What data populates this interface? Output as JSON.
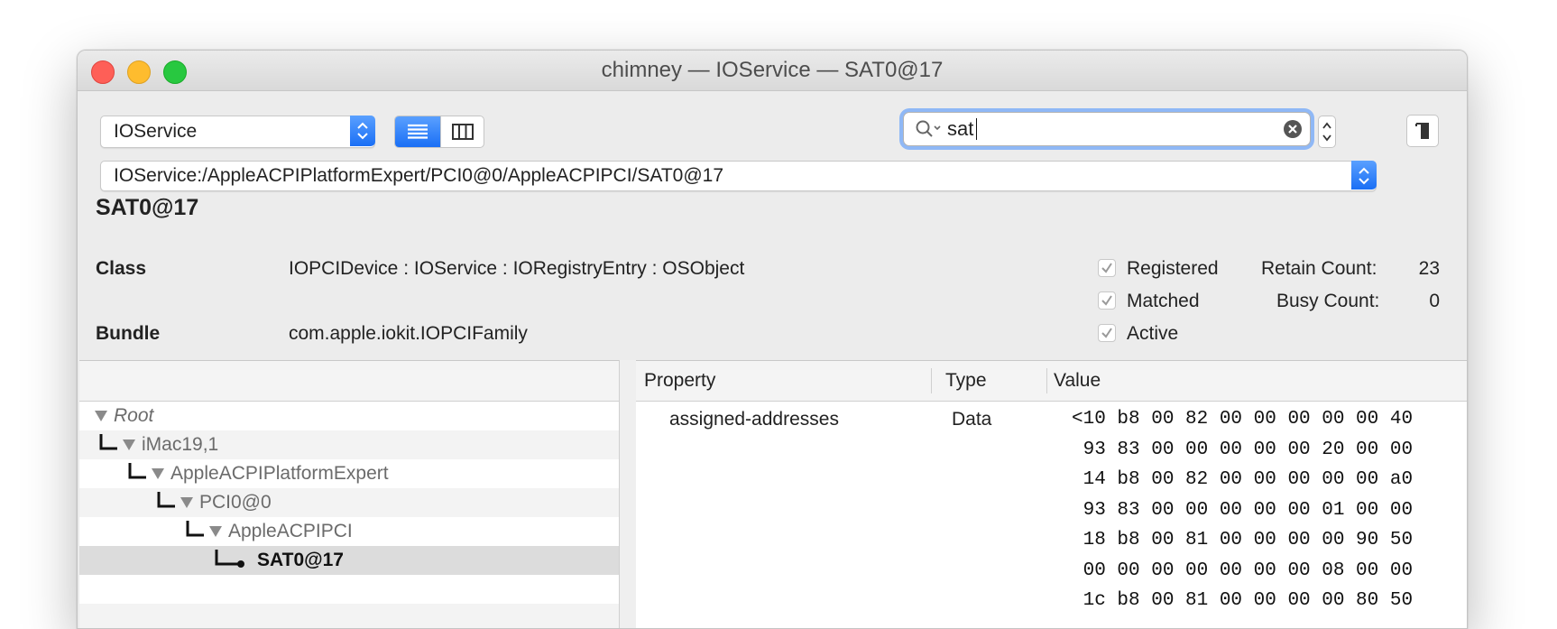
{
  "window": {
    "title": "chimney — IOService — SAT0@17"
  },
  "toolbar": {
    "plane_select": "IOService",
    "search_value": "sat",
    "path": "IOService:/AppleACPIPlatformExpert/PCI0@0/AppleACPIPCI/SAT0@17"
  },
  "details": {
    "name": "SAT0@17",
    "class_label": "Class",
    "class_value": "IOPCIDevice : IOService : IORegistryEntry : OSObject",
    "bundle_label": "Bundle",
    "bundle_value": "com.apple.iokit.IOPCIFamily",
    "checks": [
      "Registered",
      "Matched",
      "Active"
    ],
    "retain_label": "Retain Count:",
    "retain_value": "23",
    "busy_label": "Busy Count:",
    "busy_value": "0"
  },
  "tree": {
    "items": [
      {
        "label": "Root",
        "depth": 0
      },
      {
        "label": "iMac19,1",
        "depth": 1
      },
      {
        "label": "AppleACPIPlatformExpert",
        "depth": 2
      },
      {
        "label": "PCI0@0",
        "depth": 3
      },
      {
        "label": "AppleACPIPCI",
        "depth": 4
      },
      {
        "label": "SAT0@17",
        "depth": 5
      }
    ]
  },
  "properties": {
    "headers": [
      "Property",
      "Type",
      "Value"
    ],
    "row": {
      "property": "assigned-addresses",
      "type": "Data",
      "value_lines": [
        "<10 b8 00 82 00 00 00 00 00 40",
        " 93 83 00 00 00 00 00 20 00 00",
        " 14 b8 00 82 00 00 00 00 00 a0",
        " 93 83 00 00 00 00 00 01 00 00",
        " 18 b8 00 81 00 00 00 00 90 50",
        " 00 00 00 00 00 00 00 08 00 00",
        " 1c b8 00 81 00 00 00 00 80 50"
      ]
    }
  }
}
